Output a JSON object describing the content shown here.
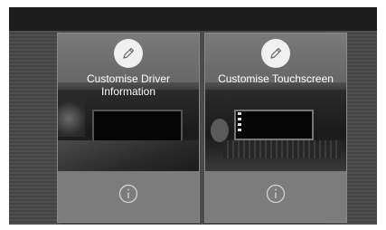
{
  "cards": [
    {
      "title_line1": "Customise Driver",
      "title_line2": "Information",
      "edit_icon": "pencil-icon",
      "info_icon": "info-icon"
    },
    {
      "title_line1": "Customise Touchscreen",
      "edit_icon": "pencil-icon",
      "info_icon": "info-icon"
    }
  ],
  "colors": {
    "background": "#4a4a4a",
    "card": "#7c7c7c",
    "icon_circle": "#f0f0f0"
  }
}
